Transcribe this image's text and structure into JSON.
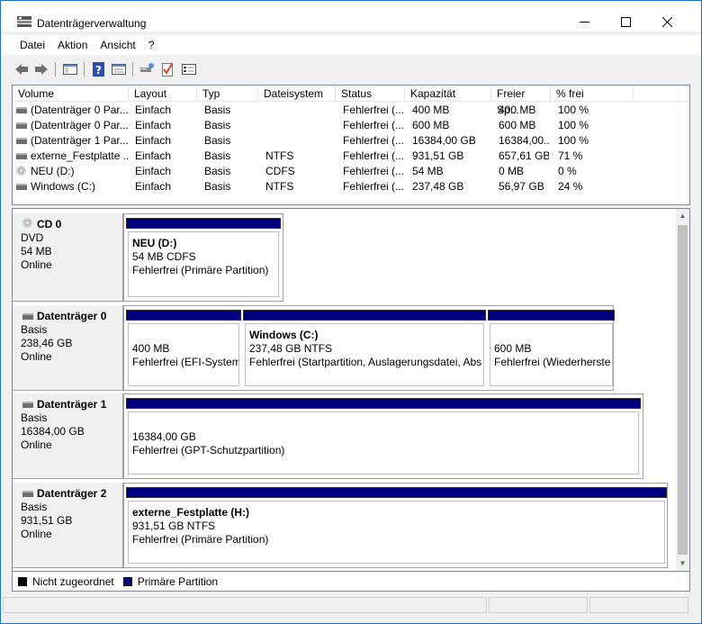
{
  "window": {
    "title": "Datenträgerverwaltung"
  },
  "menu": [
    "Datei",
    "Aktion",
    "Ansicht",
    "?"
  ],
  "toolbar_icons": [
    "back-icon",
    "forward-icon",
    "console-tree-icon",
    "help-icon",
    "properties-icon",
    "connect-icon",
    "check-icon",
    "list-icon"
  ],
  "volume_list": {
    "columns": [
      "Volume",
      "Layout",
      "Typ",
      "Dateisystem",
      "Status",
      "Kapazität",
      "Freier Sp...",
      "% frei"
    ],
    "rows": [
      {
        "icon": "drive",
        "cells": [
          "(Datenträger 0 Par...",
          "Einfach",
          "Basis",
          "",
          "Fehlerfrei (...",
          "400 MB",
          "400 MB",
          "100 %"
        ]
      },
      {
        "icon": "drive",
        "cells": [
          "(Datenträger 0 Par...",
          "Einfach",
          "Basis",
          "",
          "Fehlerfrei (...",
          "600 MB",
          "600 MB",
          "100 %"
        ]
      },
      {
        "icon": "drive",
        "cells": [
          "(Datenträger 1 Par...",
          "Einfach",
          "Basis",
          "",
          "Fehlerfrei (...",
          "16384,00 GB",
          "16384,00...",
          "100 %"
        ]
      },
      {
        "icon": "drive",
        "cells": [
          "externe_Festplatte ...",
          "Einfach",
          "Basis",
          "NTFS",
          "Fehlerfrei (...",
          "931,51 GB",
          "657,61 GB",
          "71 %"
        ]
      },
      {
        "icon": "cd",
        "cells": [
          "NEU (D:)",
          "Einfach",
          "Basis",
          "CDFS",
          "Fehlerfrei (...",
          "54 MB",
          "0 MB",
          "0 %"
        ]
      },
      {
        "icon": "drive",
        "cells": [
          "Windows (C:)",
          "Einfach",
          "Basis",
          "NTFS",
          "Fehlerfrei (...",
          "237,48 GB",
          "56,97 GB",
          "24 %"
        ]
      }
    ]
  },
  "disks": [
    {
      "name": "CD 0",
      "type": "DVD",
      "size": "54 MB",
      "status": "Online",
      "icon": "cd",
      "partitions": [
        {
          "name": "NEU  (D:)",
          "line1": "54 MB CDFS",
          "line2": "Fehlerfrei (Primäre Partition)"
        }
      ]
    },
    {
      "name": "Datenträger 0",
      "type": "Basis",
      "size": "238,46 GB",
      "status": "Online",
      "icon": "drive",
      "partitions": [
        {
          "name": "",
          "line1": "400 MB",
          "line2": "Fehlerfrei (EFI-System"
        },
        {
          "name": "Windows  (C:)",
          "line1": "237,48 GB NTFS",
          "line2": "Fehlerfrei (Startpartition, Auslagerungsdatei, Abs"
        },
        {
          "name": "",
          "line1": "600 MB",
          "line2": "Fehlerfrei (Wiederherste"
        }
      ]
    },
    {
      "name": "Datenträger 1",
      "type": "Basis",
      "size": "16384,00 GB",
      "status": "Online",
      "icon": "drive",
      "partitions": [
        {
          "name": "",
          "line1": "16384,00 GB",
          "line2": "Fehlerfrei (GPT-Schutzpartition)"
        }
      ]
    },
    {
      "name": "Datenträger 2",
      "type": "Basis",
      "size": "931,51 GB",
      "status": "Online",
      "icon": "drive",
      "partitions": [
        {
          "name": "externe_Festplatte  (H:)",
          "line1": "931,51 GB NTFS",
          "line2": "Fehlerfrei (Primäre Partition)"
        }
      ]
    }
  ],
  "legend": [
    {
      "label": "Nicht zugeordnet",
      "color": "#000000"
    },
    {
      "label": "Primäre Partition",
      "color": "#00007f"
    }
  ]
}
